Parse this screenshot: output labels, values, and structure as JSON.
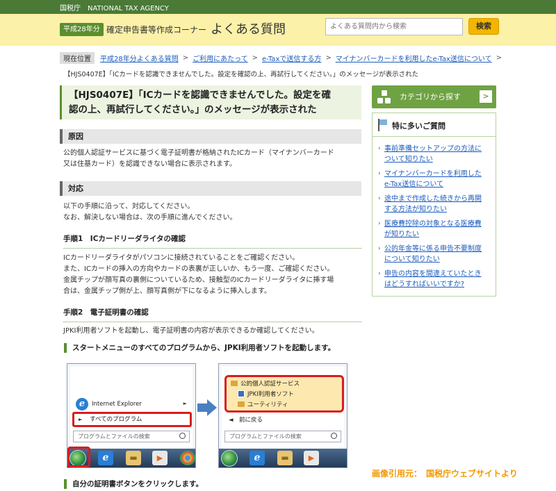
{
  "topbar": {
    "agency": "国税庁　NATIONAL TAX AGENCY"
  },
  "header": {
    "year_badge": "平成28年分",
    "corner": "確定申告書等作成コーナー",
    "faq_title": "よくある質問",
    "search_placeholder": "よくある質問内から検索",
    "search_button": "検索"
  },
  "breadcrumb": {
    "label": "現在位置",
    "links": [
      "平成28年分よくある質問",
      "ご利用にあたって",
      "e-Taxで送信する方",
      "マイナンバーカードを利用したe-Tax送信について"
    ],
    "sep": ">",
    "current": "【HJS0407E】「ICカードを認識できませんでした。設定を確認の上、再試行してください。」のメッセージが表示された"
  },
  "main": {
    "title_line1": "【HJS0407E】「ICカードを認識できませんでした。設定を確",
    "title_line2": "認の上、再試行してください。」のメッセージが表示された",
    "cause_head": "原因",
    "cause_line1": "公的個人認証サービスに基づく電子証明書が格納されたICカード（マイナンバーカード",
    "cause_line2": "又は住基カード）を認識できない場合に表示されます。",
    "action_head": "対応",
    "action_line1": "以下の手順に沿って、対応してください。",
    "action_line2": "なお、解決しない場合は、次の手順に進んでください。",
    "step1_head": "手順1　ICカードリーダライタの確認",
    "step1_line1": "ICカードリーダライタがパソコンに接続されていることをご確認ください。",
    "step1_line2": "また、ICカードの挿入の方向やカードの表裏が正しいか、もう一度、ご確認ください。",
    "step1_line3": "金属チップが顔写真の裏側についているため、接触型のICカードリーダライタに挿す場",
    "step1_line4": "合は、金属チップ側が上、顔写真側が下になるように挿入します。",
    "step2_head": "手順2　電子証明書の確認",
    "step2_line1": "JPKI利用者ソフトを起動し、電子証明書の内容が表示できるか確認してください。",
    "green_head1": "スタートメニューのすべてのプログラムから、JPKI利用者ソフトを起動します。",
    "green_head2": "自分の証明書ボタンをクリックします。"
  },
  "shot1": {
    "ie_label": "Internet Explorer",
    "all_programs": "すべてのプログラム",
    "search_placeholder": "プログラムとファイルの検索",
    "arrow": "►",
    "all_arrow": "►"
  },
  "shot2": {
    "folder1": "公的個人認証サービス",
    "app": "JPKI利用者ソフト",
    "folder2": "ユーティリティ",
    "back": "◄　前に戻る",
    "search_placeholder": "プログラムとファイルの検索"
  },
  "credit": "画像引用元：　国税庁ウェブサイトより",
  "sidebar": {
    "category_label": "カテゴリから探す",
    "chevron": ">",
    "faq_head": "特に多いご質問",
    "caret": "›",
    "items": [
      {
        "line1": "事前準備セットアップの方法に",
        "line2": "ついて知りたい"
      },
      {
        "line1": "マイナンバーカードを利用した",
        "line2": "e-Tax送信について"
      },
      {
        "line1": "途中まで作成した続きから再開",
        "line2": "する方法が知りたい"
      },
      {
        "line1": "医療費控除の対象となる医療費",
        "line2": "が知りたい"
      },
      {
        "line1": "公的年金等に係る申告不要制度",
        "line2": "について知りたい"
      },
      {
        "line1": "申告の内容を間違えていたとき",
        "line2": "はどうすればいいですか?"
      }
    ]
  },
  "colors": {
    "accent_green": "#5b8f2f",
    "header_yellow": "#fbf1a8",
    "search_button": "#f3b500",
    "link_blue": "#1a5bbd",
    "highlight_red": "#d91c1c",
    "credit_orange": "#f39800"
  }
}
